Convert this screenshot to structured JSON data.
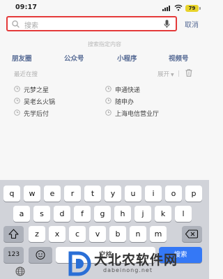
{
  "status_bar": {
    "time": "09:17",
    "battery": "79"
  },
  "search": {
    "placeholder": "搜索",
    "cancel_label": "取消"
  },
  "search_types": {
    "title": "搜索指定内容",
    "items": [
      "朋友圈",
      "公众号",
      "小程序",
      "视频号"
    ]
  },
  "recent": {
    "title": "最近在搜",
    "expand_label": "展开",
    "items": [
      "元梦之星",
      "申通快递",
      "吴老幺火锅",
      "随申办",
      "先学后付",
      "上海电信营业厅"
    ]
  },
  "keyboard": {
    "row1": [
      "q",
      "w",
      "e",
      "r",
      "t",
      "y",
      "u",
      "i",
      "o",
      "p"
    ],
    "row2": [
      "a",
      "s",
      "d",
      "f",
      "g",
      "h",
      "j",
      "k",
      "l"
    ],
    "row3": [
      "z",
      "x",
      "c",
      "v",
      "b",
      "n",
      "m"
    ],
    "numbers_label": "123",
    "space_label": "空格",
    "search_label": "搜索"
  },
  "colors": {
    "accent_link": "#576b95",
    "highlight_border": "#e43a3a",
    "search_key": "#3478f6"
  },
  "watermark": {
    "text": "大北农软件网",
    "url": "dabeinong.net"
  }
}
